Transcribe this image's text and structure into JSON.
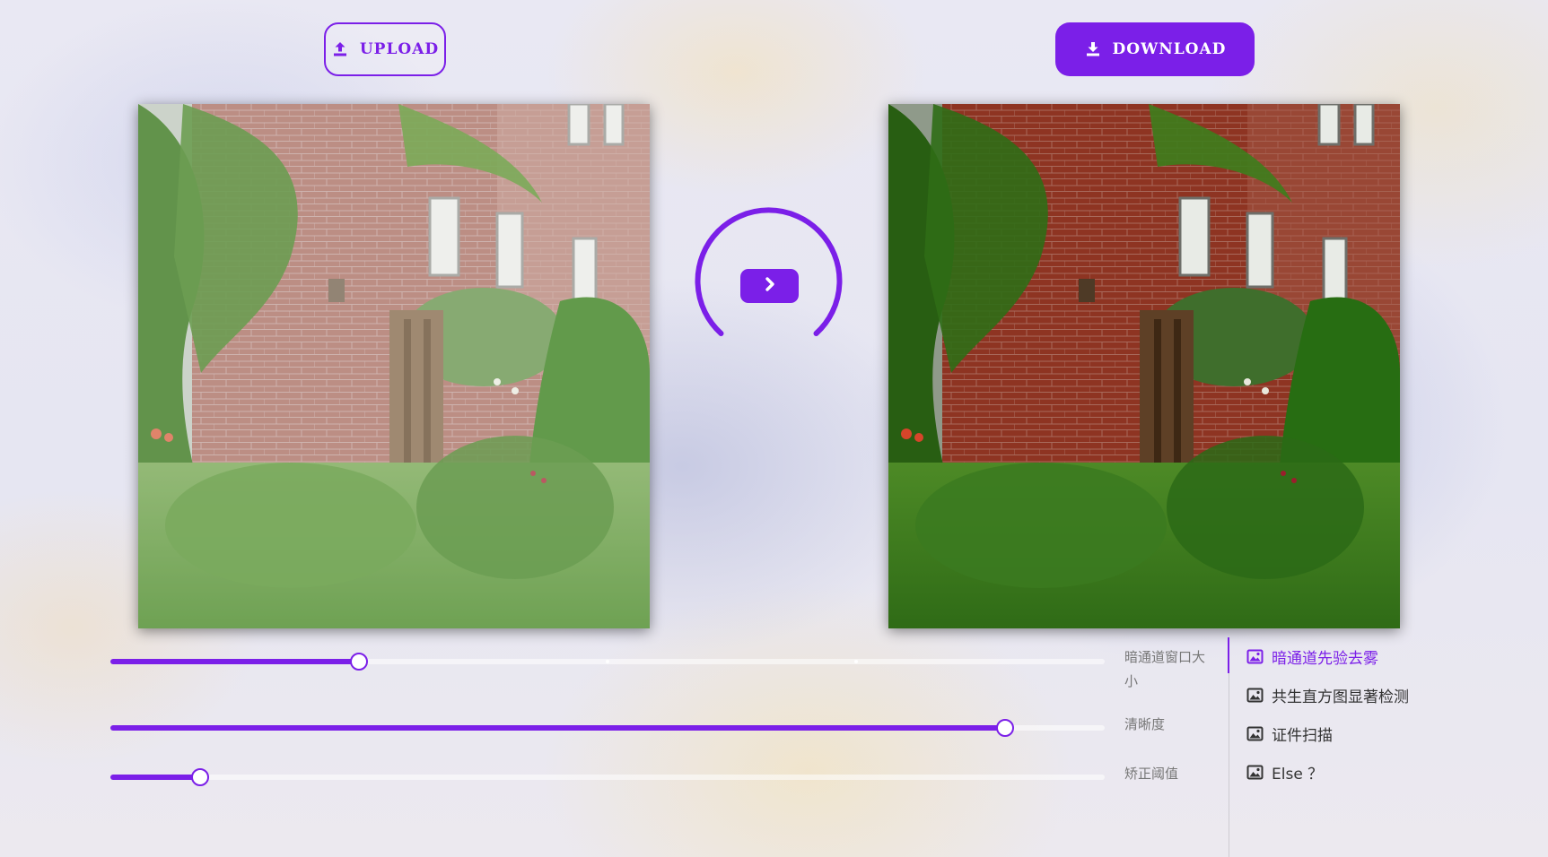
{
  "toolbar": {
    "upload_label": "UPLOAD",
    "download_label": "DOWNLOAD"
  },
  "colors": {
    "accent": "#7b1fe8",
    "menu_text": "#333333",
    "label_text": "#777777"
  },
  "images": {
    "original": "hazy-garden-photo",
    "result": "dehazed-garden-photo"
  },
  "action": {
    "run_icon": "chevron-right-icon"
  },
  "sliders": [
    {
      "label": "暗通道窗口大小",
      "value": 0.25
    },
    {
      "label": "清晰度",
      "value": 0.9
    },
    {
      "label": "矫正阈值",
      "value": 0.09
    }
  ],
  "menu": [
    {
      "label": "暗通道先验去雾",
      "icon": "image-icon",
      "active": true
    },
    {
      "label": "共生直方图显著检测",
      "icon": "image-icon",
      "active": false
    },
    {
      "label": "证件扫描",
      "icon": "image-icon",
      "active": false
    },
    {
      "label": "Else ？",
      "icon": "image-icon",
      "active": false
    }
  ]
}
